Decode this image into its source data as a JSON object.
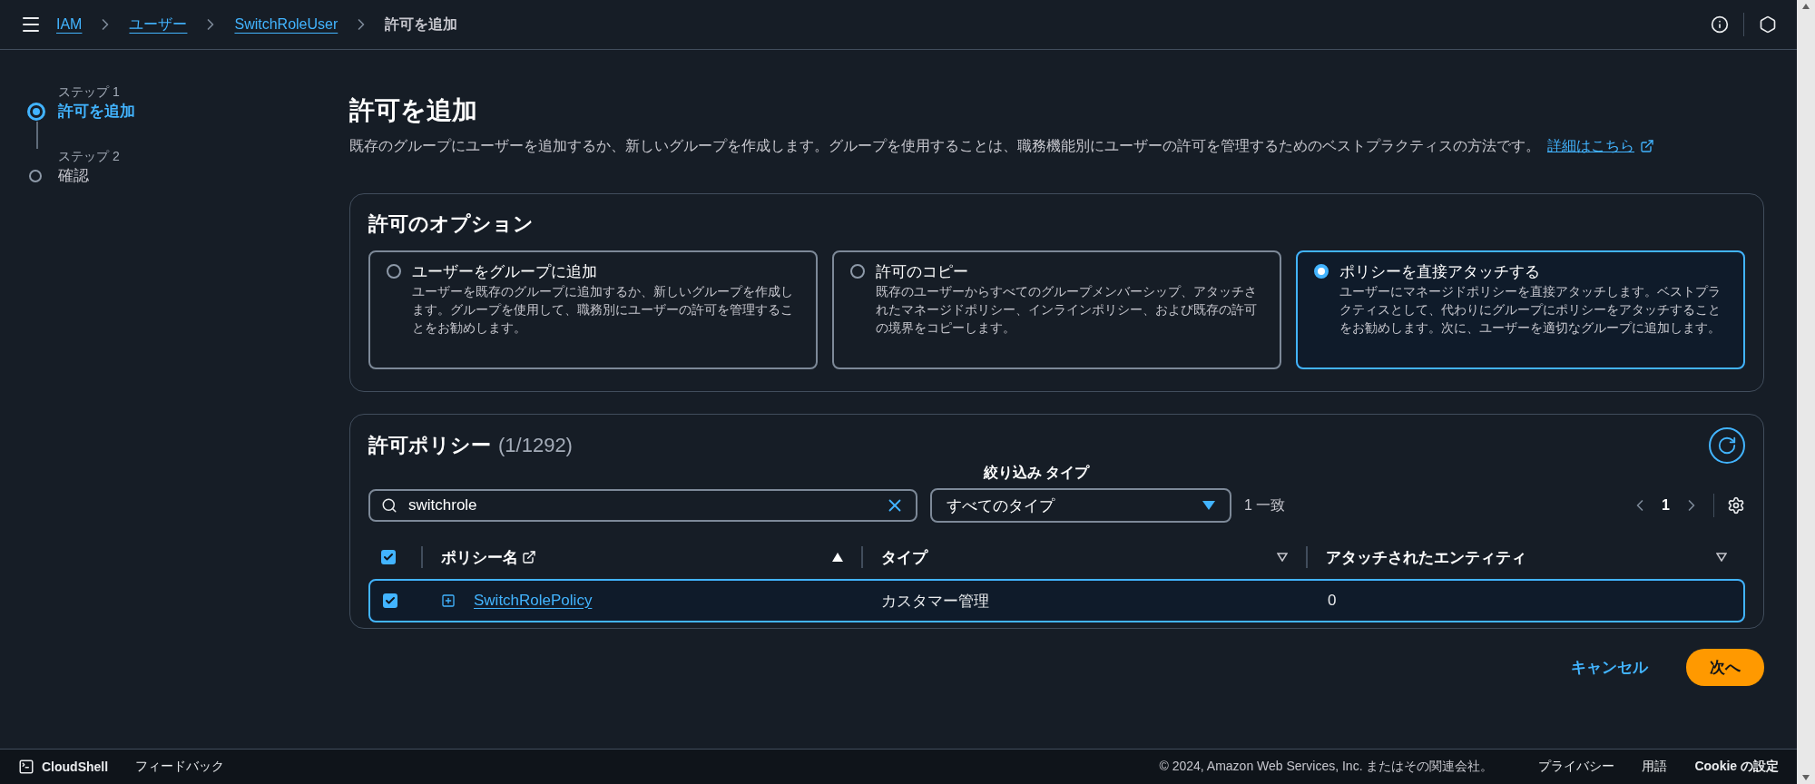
{
  "breadcrumbs": [
    {
      "label": "IAM",
      "link": true
    },
    {
      "label": "ユーザー",
      "link": true
    },
    {
      "label": "SwitchRoleUser",
      "link": true
    },
    {
      "label": "許可を追加",
      "link": false
    }
  ],
  "steps": [
    {
      "step": "ステップ 1",
      "label": "許可を追加",
      "selected": true
    },
    {
      "step": "ステップ 2",
      "label": "確認",
      "selected": false
    }
  ],
  "page": {
    "title": "許可を追加",
    "description": "既存のグループにユーザーを追加するか、新しいグループを作成します。グループを使用することは、職務機能別にユーザーの許可を管理するためのベストプラクティスの方法です。",
    "link": "詳細はこちら"
  },
  "options": {
    "title": "許可のオプション",
    "items": [
      {
        "title": "ユーザーをグループに追加",
        "description": "ユーザーを既存のグループに追加するか、新しいグループを作成します。グループを使用して、職務別にユーザーの許可を管理することをお勧めします。",
        "selected": false
      },
      {
        "title": "許可のコピー",
        "description": "既存のユーザーからすべてのグループメンバーシップ、アタッチされたマネージドポリシー、インラインポリシー、および既存の許可の境界をコピーします。",
        "selected": false
      },
      {
        "title": "ポリシーを直接アタッチする",
        "description": "ユーザーにマネージドポリシーを直接アタッチします。ベストプラクティスとして、代わりにグループにポリシーをアタッチすることをお勧めします。次に、ユーザーを適切なグループに追加します。",
        "selected": true
      }
    ]
  },
  "policies": {
    "title": "許可ポリシー",
    "count": "(1/1292)",
    "filter_label": "絞り込み タイプ",
    "search_value": "switchrole",
    "filter_value": "すべてのタイプ",
    "matches": "1 一致",
    "page": "1",
    "header_checked": true,
    "columns": [
      {
        "label": "ポリシー名",
        "sorted": true
      },
      {
        "label": "タイプ",
        "sorted": false
      },
      {
        "label": "アタッチされたエンティティ",
        "sorted": false
      }
    ],
    "rows": [
      {
        "name": "SwitchRolePolicy",
        "type": "カスタマー管理",
        "entities": "0",
        "selected": true
      }
    ]
  },
  "actions": {
    "cancel": "キャンセル",
    "next": "次へ"
  },
  "footer": {
    "cloudshell": "CloudShell",
    "feedback": "フィードバック",
    "copyright": "© 2024, Amazon Web Services, Inc. またはその関連会社。",
    "links": [
      "プライバシー",
      "用語",
      "Cookie の設定"
    ]
  }
}
